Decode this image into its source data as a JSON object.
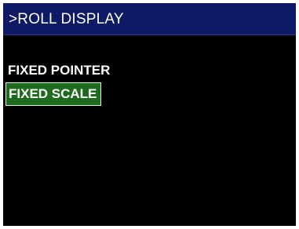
{
  "header": {
    "title": ">ROLL DISPLAY"
  },
  "menu": {
    "items": [
      {
        "label": "FIXED POINTER",
        "selected": false
      },
      {
        "label": "FIXED SCALE",
        "selected": true
      }
    ]
  },
  "colors": {
    "screen_background": "#000000",
    "header_background": "#0f1a66",
    "text": "#ffffff",
    "selected_background": "#1e6b1e",
    "selected_border": "#e8f0e8"
  }
}
